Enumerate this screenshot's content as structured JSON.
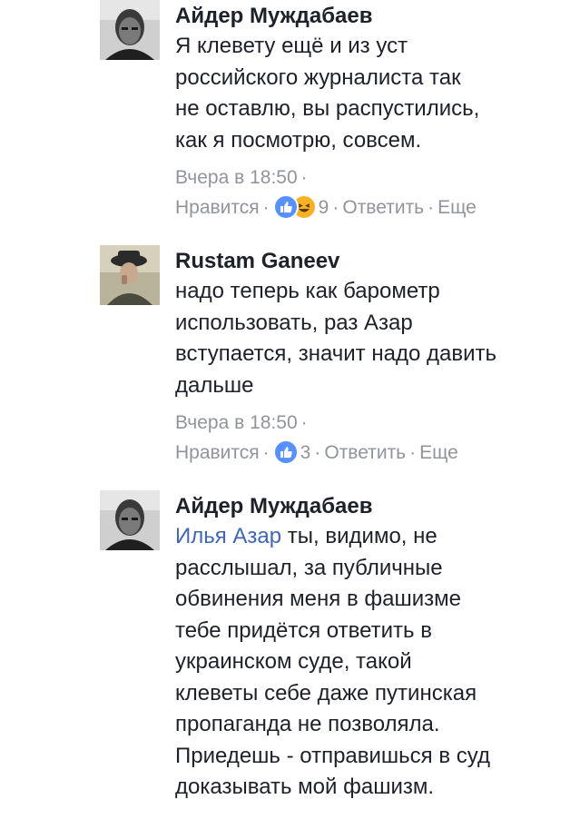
{
  "comments": [
    {
      "author": "Айдер Муждабаев",
      "mention": "",
      "lines": [
        "Я клевету ещё и из уст",
        "российского журналиста так",
        "не оставлю, вы распустились,",
        "как я посмотрю, совсем."
      ],
      "time": "Вчера в 18:50",
      "like_label": "Нравится",
      "reaction_count": "9",
      "reply_label": "Ответить",
      "more_label": "Еще",
      "reactions": [
        "like-icon",
        "haha-icon"
      ]
    },
    {
      "author": "Rustam Ganeev",
      "mention": "",
      "lines": [
        "надо теперь как барометр",
        "использовать, раз Азар",
        "вступается, значит надо давить",
        "дальше"
      ],
      "time": "Вчера в 18:50",
      "like_label": "Нравится",
      "reaction_count": "3",
      "reply_label": "Ответить",
      "more_label": "Еще",
      "reactions": [
        "like-icon"
      ]
    },
    {
      "author": "Айдер Муждабаев",
      "mention": "Илья Азар",
      "first_line_rest": " ты, видимо, не",
      "lines": [
        "расслышал, за публичные",
        "обвинения меня в фашизме",
        "тебе придётся ответить в",
        "украинском суде, такой",
        "клеветы себе даже путинская",
        "пропаганда не позволяла.",
        "Приедешь - отправишься в суд",
        "доказывать мой фашизм."
      ]
    }
  ],
  "colors": {
    "text": "#1d2129",
    "meta": "#90949c",
    "link": "#4267b2",
    "like": "#5890ff",
    "haha": "#f7b125"
  }
}
